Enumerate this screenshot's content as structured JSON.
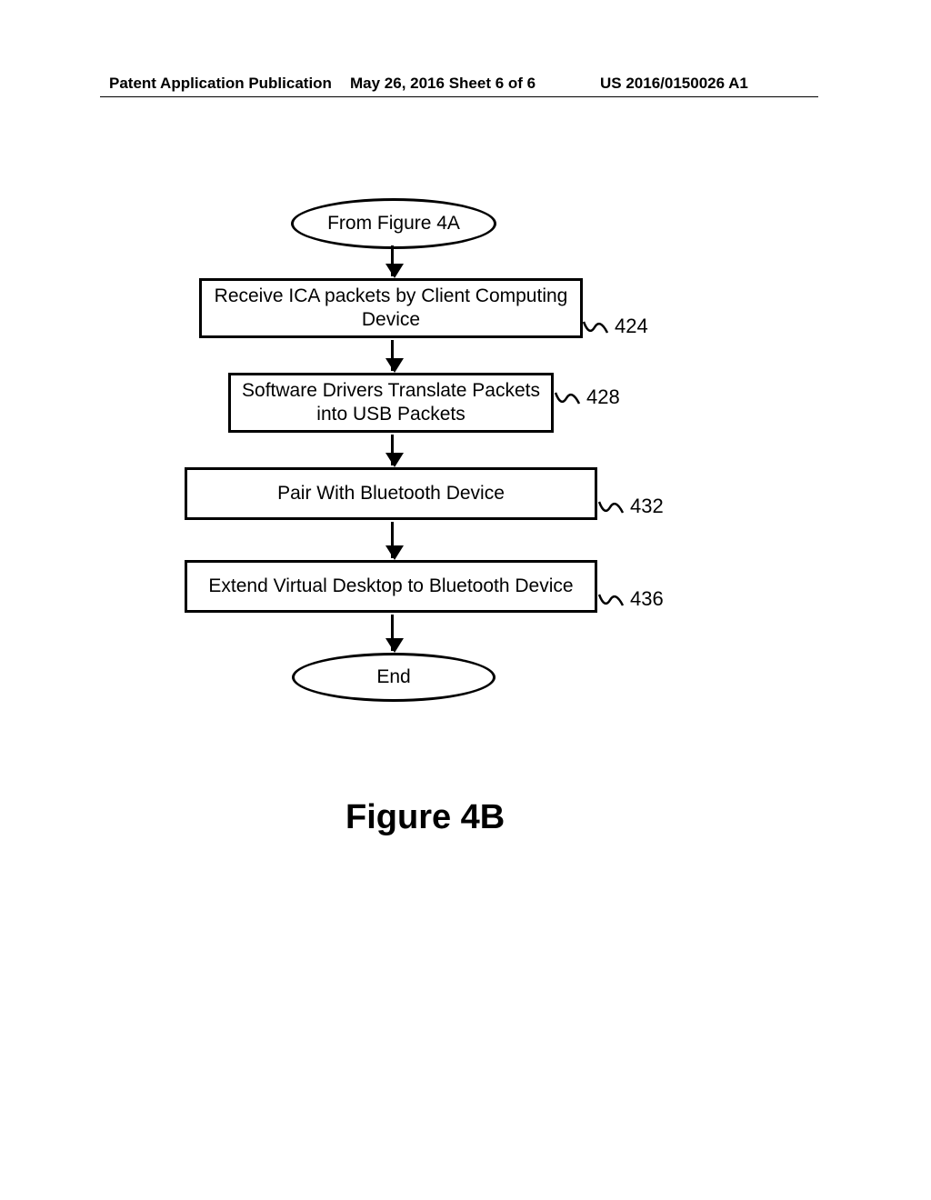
{
  "header": {
    "left": "Patent Application Publication",
    "mid": "May 26, 2016  Sheet 6 of 6",
    "right": "US 2016/0150026 A1"
  },
  "chart_data": {
    "type": "flowchart",
    "figure_label": "Figure 4B",
    "start_terminator": "From Figure 4A",
    "end_terminator": "End",
    "steps": [
      {
        "ref": "424",
        "text": "Receive ICA packets by Client Computing Device"
      },
      {
        "ref": "428",
        "text": "Software Drivers Translate Packets into USB Packets"
      },
      {
        "ref": "432",
        "text": "Pair With Bluetooth Device"
      },
      {
        "ref": "436",
        "text": "Extend Virtual Desktop to Bluetooth Device"
      }
    ]
  }
}
